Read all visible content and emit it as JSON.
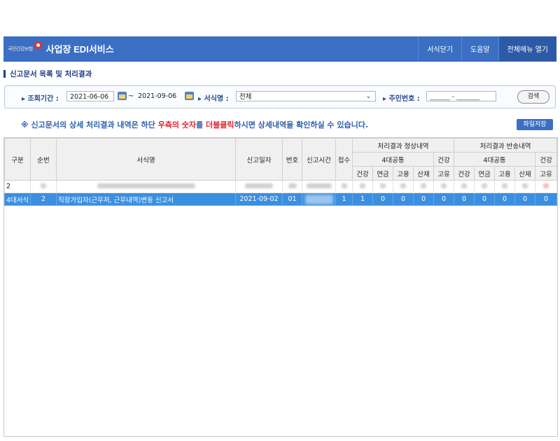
{
  "header": {
    "logo_text": "국민건강보험",
    "app_title": "사업장 EDI서비스",
    "links": [
      "서식닫기",
      "도움말",
      "전체메뉴 열기"
    ]
  },
  "section": {
    "title": "신고문서 목록 및 처리결과"
  },
  "search": {
    "period_label": "조회기간 :",
    "date_from": "2021-06-06",
    "tilde": "~",
    "date_to": "2021-09-06",
    "form_label": "서식명 :",
    "form_value": "전체",
    "id_label": "주민번호 :",
    "id_placeholder": "______ - _______",
    "search_button": "검색"
  },
  "notice": {
    "prefix": "※ 신고문서의 상세 처리결과 내역은 하단 ",
    "red1": "우측의 숫자",
    "mid": "를 ",
    "red2": "더블클릭",
    "suffix": "하시면 상세내역을 확인하실 수 있습니다."
  },
  "save_button": "파일저장",
  "table": {
    "headers": {
      "gubun": "구분",
      "sunbun": "순번",
      "form_name": "서식명",
      "report_date": "신고일자",
      "number": "번호",
      "report_time": "신고시간",
      "receipt": "접수",
      "normal_group": "처리결과 정상내역",
      "return_group": "처리결과 반송내역",
      "four_common": "4대공통",
      "health": "건강",
      "sub": [
        "건강",
        "연금",
        "고용",
        "산재",
        "고유"
      ]
    },
    "blurred_row": {
      "gubun": "2"
    },
    "selected_row": {
      "gubun": "4대서식",
      "sunbun": "2",
      "form_name": "직장가입자(근무처, 근무내역)변동 신고서",
      "report_date": "2021-09-02",
      "number": "01",
      "report_time": "",
      "receipt": "1",
      "normal": [
        "1",
        "0",
        "0",
        "0",
        "0"
      ],
      "returned": [
        "0",
        "0",
        "0",
        "0",
        "0"
      ]
    }
  }
}
